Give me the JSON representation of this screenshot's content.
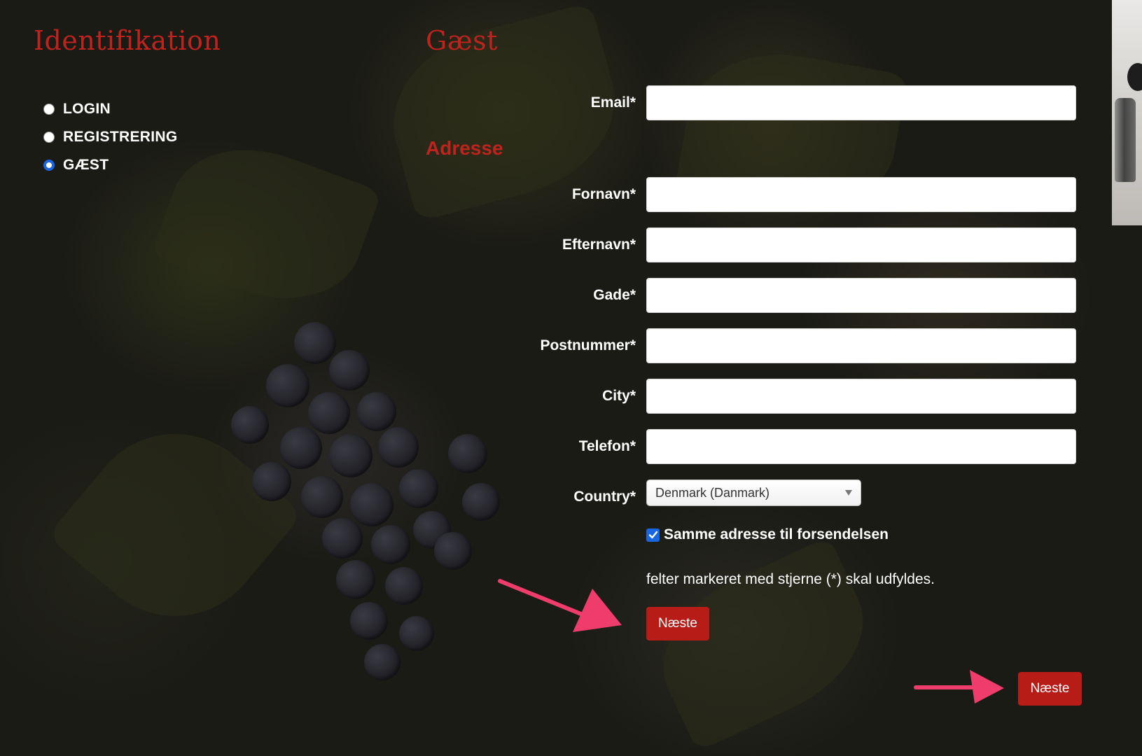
{
  "left_section": {
    "title": "Identifikation",
    "options": [
      {
        "label": "LOGIN",
        "checked": false
      },
      {
        "label": "REGISTRERING",
        "checked": false
      },
      {
        "label": "GÆST",
        "checked": true
      }
    ]
  },
  "guest_section": {
    "title": "Gæst",
    "email_label": "Email*",
    "address_title": "Adresse",
    "fields": {
      "first_name_label": "Fornavn*",
      "last_name_label": "Efternavn*",
      "street_label": "Gade*",
      "postal_label": "Postnummer*",
      "city_label": "City*",
      "phone_label": "Telefon*",
      "country_label": "Country*"
    },
    "country_value": "Denmark (Danmark)",
    "same_address_label": "Samme adresse til forsendelsen",
    "same_address_checked": true,
    "required_note": "felter markeret med stjerne (*) skal udfyldes.",
    "next_button_label": "Næste"
  },
  "footer": {
    "next_button_label": "Næste"
  },
  "colors": {
    "accent_red": "#c0231e",
    "button_red": "#b71c17",
    "annotation_arrow": "#ee3d6c",
    "check_blue": "#1a66e0"
  }
}
